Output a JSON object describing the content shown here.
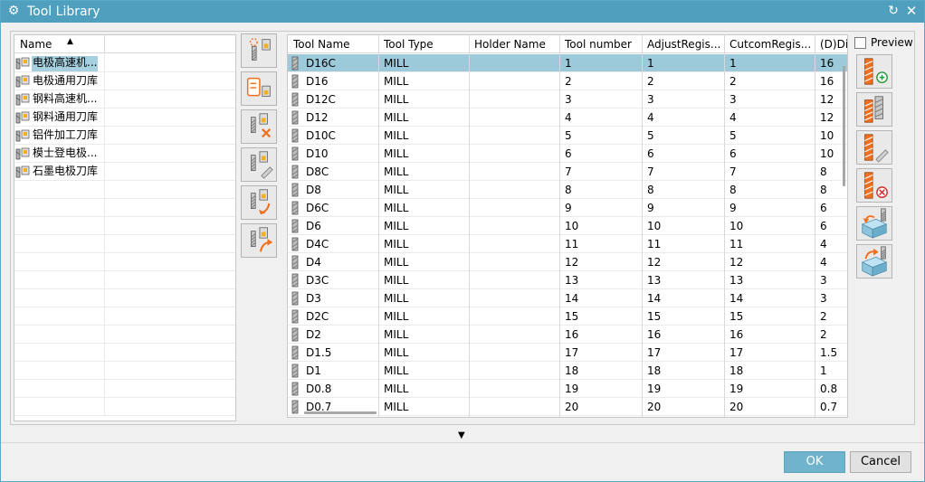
{
  "window": {
    "title": "Tool Library",
    "settings_icon": "gear-icon",
    "reset_icon": "reset-icon",
    "close_icon": "close-icon"
  },
  "library_list": {
    "header": "Name",
    "items": [
      {
        "label": "电极高速机..."
      },
      {
        "label": "电极通用刀库"
      },
      {
        "label": "钢料高速机..."
      },
      {
        "label": "钢料通用刀库"
      },
      {
        "label": "铝件加工刀库"
      },
      {
        "label": "模士登电极..."
      },
      {
        "label": "石墨电极刀库"
      }
    ],
    "selected_index": 0
  },
  "library_actions": [
    {
      "name": "new-library-button",
      "icon": "new-library-icon"
    },
    {
      "name": "import-library-button",
      "icon": "import-library-icon"
    },
    {
      "name": "delete-library-button",
      "icon": "delete-library-icon"
    },
    {
      "name": "edit-library-button",
      "icon": "edit-library-icon"
    },
    {
      "name": "import-tools-button",
      "icon": "import-tools-icon"
    },
    {
      "name": "export-tools-button",
      "icon": "export-tools-icon"
    }
  ],
  "tool_table": {
    "columns": [
      "Tool Name",
      "Tool Type",
      "Holder Name",
      "Tool number",
      "AdjustRegis...",
      "CutcomRegis...",
      "(D)Dia"
    ],
    "rows": [
      [
        "D16C",
        "MILL",
        "",
        "1",
        "1",
        "1",
        "16"
      ],
      [
        "D16",
        "MILL",
        "",
        "2",
        "2",
        "2",
        "16"
      ],
      [
        "D12C",
        "MILL",
        "",
        "3",
        "3",
        "3",
        "12"
      ],
      [
        "D12",
        "MILL",
        "",
        "4",
        "4",
        "4",
        "12"
      ],
      [
        "D10C",
        "MILL",
        "",
        "5",
        "5",
        "5",
        "10"
      ],
      [
        "D10",
        "MILL",
        "",
        "6",
        "6",
        "6",
        "10"
      ],
      [
        "D8C",
        "MILL",
        "",
        "7",
        "7",
        "7",
        "8"
      ],
      [
        "D8",
        "MILL",
        "",
        "8",
        "8",
        "8",
        "8"
      ],
      [
        "D6C",
        "MILL",
        "",
        "9",
        "9",
        "9",
        "6"
      ],
      [
        "D6",
        "MILL",
        "",
        "10",
        "10",
        "10",
        "6"
      ],
      [
        "D4C",
        "MILL",
        "",
        "11",
        "11",
        "11",
        "4"
      ],
      [
        "D4",
        "MILL",
        "",
        "12",
        "12",
        "12",
        "4"
      ],
      [
        "D3C",
        "MILL",
        "",
        "13",
        "13",
        "13",
        "3"
      ],
      [
        "D3",
        "MILL",
        "",
        "14",
        "14",
        "14",
        "3"
      ],
      [
        "D2C",
        "MILL",
        "",
        "15",
        "15",
        "15",
        "2"
      ],
      [
        "D2",
        "MILL",
        "",
        "16",
        "16",
        "16",
        "2"
      ],
      [
        "D1.5",
        "MILL",
        "",
        "17",
        "17",
        "17",
        "1.5"
      ],
      [
        "D1",
        "MILL",
        "",
        "18",
        "18",
        "18",
        "1"
      ],
      [
        "D0.8",
        "MILL",
        "",
        "19",
        "19",
        "19",
        "0.8"
      ],
      [
        "D0.7",
        "MILL",
        "",
        "20",
        "20",
        "20",
        "0.7"
      ]
    ],
    "selected_row": 0
  },
  "preview": {
    "label": "Preview",
    "checked": false
  },
  "tool_actions": [
    {
      "name": "add-tool-button",
      "icon": "add-tool-icon"
    },
    {
      "name": "copy-tool-button",
      "icon": "copy-tool-icon"
    },
    {
      "name": "edit-tool-button",
      "icon": "edit-tool-icon"
    },
    {
      "name": "delete-tool-button",
      "icon": "delete-tool-icon"
    },
    {
      "name": "retrieve-tool-button",
      "icon": "retrieve-tool-icon"
    },
    {
      "name": "export-tool-button",
      "icon": "export-tool-icon"
    }
  ],
  "footer": {
    "ok_label": "OK",
    "cancel_label": "Cancel"
  },
  "colors": {
    "title_bar": "#4f9fbf",
    "selection": "#9ccadb",
    "accent_orange": "#f07020",
    "ok_button": "#6fb3cc"
  }
}
